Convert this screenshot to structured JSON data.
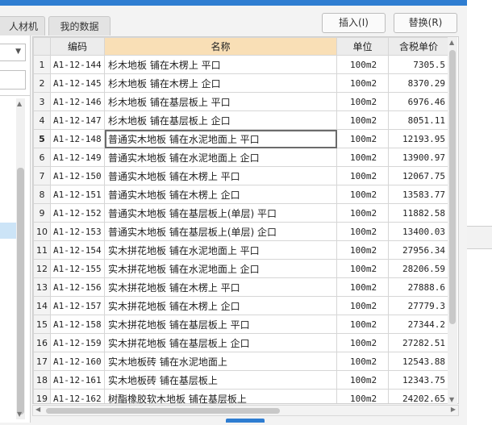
{
  "tabs": [
    "人材机",
    "我的数据"
  ],
  "buttons": {
    "insert": "插入(I)",
    "replace": "替换(R)"
  },
  "columns": {
    "code": "编码",
    "name": "名称",
    "unit": "单位",
    "price": "含税单价"
  },
  "current_row": 5,
  "rows": [
    {
      "idx": "1",
      "code": "A1-12-144",
      "name": "杉木地板 铺在木楞上 平口",
      "unit": "100m2",
      "price": "7305.5"
    },
    {
      "idx": "2",
      "code": "A1-12-145",
      "name": "杉木地板 铺在木楞上 企口",
      "unit": "100m2",
      "price": "8370.29"
    },
    {
      "idx": "3",
      "code": "A1-12-146",
      "name": "杉木地板 铺在基层板上 平口",
      "unit": "100m2",
      "price": "6976.46"
    },
    {
      "idx": "4",
      "code": "A1-12-147",
      "name": "杉木地板 铺在基层板上 企口",
      "unit": "100m2",
      "price": "8051.11"
    },
    {
      "idx": "5",
      "code": "A1-12-148",
      "name": "普通实木地板 铺在水泥地面上 平口",
      "unit": "100m2",
      "price": "12193.95"
    },
    {
      "idx": "6",
      "code": "A1-12-149",
      "name": "普通实木地板 铺在水泥地面上 企口",
      "unit": "100m2",
      "price": "13900.97"
    },
    {
      "idx": "7",
      "code": "A1-12-150",
      "name": "普通实木地板 铺在木楞上 平口",
      "unit": "100m2",
      "price": "12067.75"
    },
    {
      "idx": "8",
      "code": "A1-12-151",
      "name": "普通实木地板 铺在木楞上 企口",
      "unit": "100m2",
      "price": "13583.77"
    },
    {
      "idx": "9",
      "code": "A1-12-152",
      "name": "普通实木地板 铺在基层板上(单层) 平口",
      "unit": "100m2",
      "price": "11882.58"
    },
    {
      "idx": "10",
      "code": "A1-12-153",
      "name": "普通实木地板 铺在基层板上(单层) 企口",
      "unit": "100m2",
      "price": "13400.03"
    },
    {
      "idx": "11",
      "code": "A1-12-154",
      "name": "实木拼花地板 铺在水泥地面上 平口",
      "unit": "100m2",
      "price": "27956.34"
    },
    {
      "idx": "12",
      "code": "A1-12-155",
      "name": "实木拼花地板 铺在水泥地面上 企口",
      "unit": "100m2",
      "price": "28206.59"
    },
    {
      "idx": "13",
      "code": "A1-12-156",
      "name": "实木拼花地板 铺在木楞上 平口",
      "unit": "100m2",
      "price": "27888.6"
    },
    {
      "idx": "14",
      "code": "A1-12-157",
      "name": "实木拼花地板 铺在木楞上 企口",
      "unit": "100m2",
      "price": "27779.3"
    },
    {
      "idx": "15",
      "code": "A1-12-158",
      "name": "实木拼花地板 铺在基层板上 平口",
      "unit": "100m2",
      "price": "27344.2"
    },
    {
      "idx": "16",
      "code": "A1-12-159",
      "name": "实木拼花地板 铺在基层板上 企口",
      "unit": "100m2",
      "price": "27282.51"
    },
    {
      "idx": "17",
      "code": "A1-12-160",
      "name": "实木地板砖 铺在水泥地面上",
      "unit": "100m2",
      "price": "12543.88"
    },
    {
      "idx": "18",
      "code": "A1-12-161",
      "name": "实木地板砖 铺在基层板上",
      "unit": "100m2",
      "price": "12343.75"
    },
    {
      "idx": "19",
      "code": "A1-12-162",
      "name": "树酯橡胶软木地板 铺在基层板上",
      "unit": "100m2",
      "price": "24202.65"
    }
  ],
  "icons": {
    "dropdown": "chevron-down-icon",
    "scroll_up": "arrow-up-icon",
    "scroll_down": "arrow-down-icon",
    "scroll_left": "arrow-left-icon",
    "scroll_right": "arrow-right-icon"
  },
  "colors": {
    "accent": "#2e7dd1",
    "name_header": "#f9dfb6",
    "selection": "#cce4f7"
  }
}
